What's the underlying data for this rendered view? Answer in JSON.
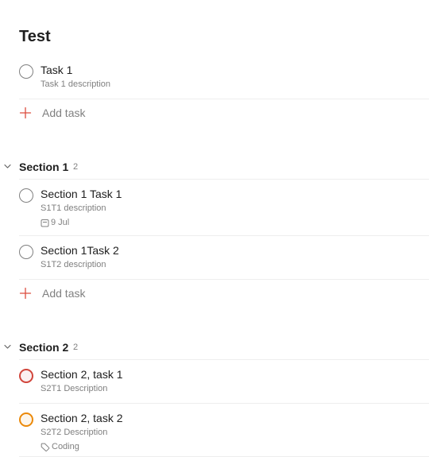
{
  "page": {
    "title": "Test"
  },
  "inbox": {
    "tasks": [
      {
        "title": "Task 1",
        "description": "Task 1 description"
      }
    ],
    "add_task_label": "Add task"
  },
  "sections": [
    {
      "title": "Section 1",
      "count": "2",
      "tasks": [
        {
          "title": "Section 1 Task 1",
          "description": "S1T1 description",
          "due": "9 Jul",
          "due_icon": "calendar-icon"
        },
        {
          "title": "Section 1Task 2",
          "description": "S1T2 description"
        }
      ],
      "add_task_label": "Add task"
    },
    {
      "title": "Section 2",
      "count": "2",
      "tasks": [
        {
          "title": "Section 2, task 1",
          "description": "S2T1 Description",
          "priority_color": "#d1453b"
        },
        {
          "title": "Section 2, task 2",
          "description": "S2T2 Description",
          "label": "Coding",
          "label_icon": "tag-icon",
          "priority_color": "#eb8909"
        }
      ]
    }
  ],
  "colors": {
    "accent": "#dc4c3e",
    "priority_1": "#d1453b",
    "priority_2": "#eb8909",
    "muted_text": "#808080",
    "divider": "#eeeeee"
  }
}
